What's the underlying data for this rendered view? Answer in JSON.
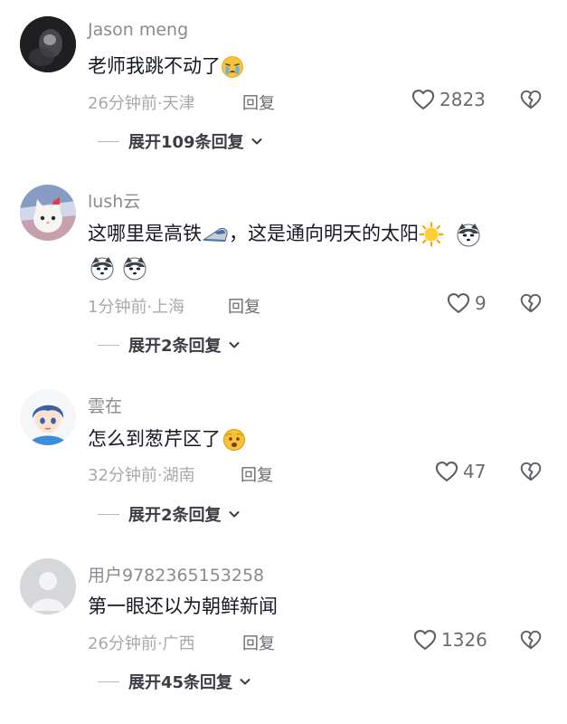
{
  "comments": [
    {
      "username": "Jason meng",
      "text": "老师我跳不动了",
      "time_location": "26分钟前·天津",
      "reply_label": "回复",
      "likes": "2823",
      "expand_label": "展开109条回复",
      "avatar_icon": "dark-photo-avatar",
      "emojis": [
        "crying-face-emoji"
      ]
    },
    {
      "username": "lush云",
      "text_part1": "这哪里是高铁",
      "text_part2": "，这是通向明天的太阳",
      "time_location": "1分钟前·上海",
      "reply_label": "回复",
      "likes": "9",
      "expand_label": "展开2条回复",
      "avatar_icon": "white-cat-avatar",
      "emojis": [
        "bullet-train-emoji",
        "sun-emoji",
        "husky-emoji",
        "husky-emoji",
        "husky-emoji"
      ]
    },
    {
      "username": "雲在",
      "text": "怎么到葱芹区了",
      "time_location": "32分钟前·湖南",
      "reply_label": "回复",
      "likes": "47",
      "expand_label": "展开2条回复",
      "avatar_icon": "anime-boy-avatar",
      "emojis": [
        "fearful-yellow-emoji"
      ]
    },
    {
      "username": "用户9782365153258",
      "text": "第一眼还以为朝鲜新闻",
      "time_location": "26分钟前·广西",
      "reply_label": "回复",
      "likes": "1326",
      "expand_label": "展开45条回复",
      "avatar_icon": "default-user-avatar",
      "emojis": []
    }
  ],
  "colors": {
    "text": "#161823",
    "muted": "#a8a9ad",
    "username": "#8a8b91",
    "expand": "#3c3d44"
  }
}
